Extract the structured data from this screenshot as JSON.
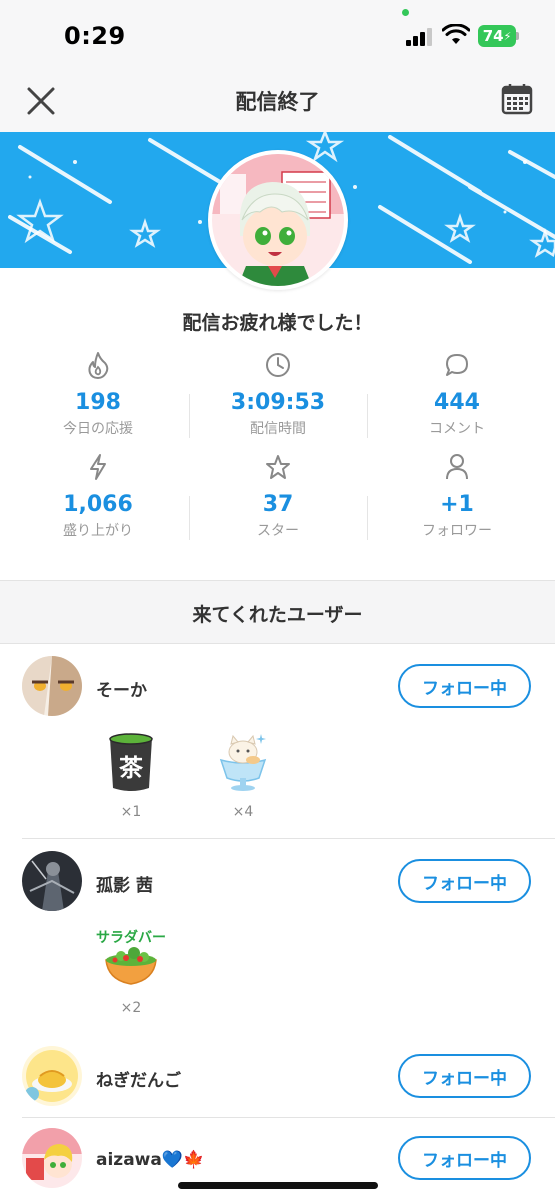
{
  "status_bar": {
    "time": "0:29",
    "battery": "74"
  },
  "nav": {
    "title": "配信終了"
  },
  "summary": {
    "message": "配信お疲れ様でした！"
  },
  "stats": [
    {
      "icon": "flame-icon",
      "value": "198",
      "label": "今日の応援"
    },
    {
      "icon": "clock-icon",
      "value": "3:09:53",
      "label": "配信時間"
    },
    {
      "icon": "comment-icon",
      "value": "444",
      "label": "コメント"
    },
    {
      "icon": "lightning-icon",
      "value": "1,066",
      "label": "盛り上がり"
    },
    {
      "icon": "star-icon",
      "value": "37",
      "label": "スター"
    },
    {
      "icon": "person-icon",
      "value": "+1",
      "label": "フォロワー"
    }
  ],
  "visitors": {
    "title": "来てくれたユーザー",
    "follow_label": "フォロー中",
    "users": [
      {
        "name": "そーか",
        "gifts": [
          {
            "icon": "tea-cup-icon",
            "count": "×1"
          },
          {
            "icon": "cat-parfait-icon",
            "count": "×4"
          }
        ]
      },
      {
        "name": "孤影 茜",
        "gifts": [
          {
            "icon": "salad-bar-icon",
            "label": "サラダバー",
            "count": "×2"
          }
        ]
      },
      {
        "name": "ねぎだんご",
        "gifts": []
      },
      {
        "name": "aizawa💙🍁",
        "gifts": []
      }
    ]
  },
  "colors": {
    "accent": "#1a8fe0",
    "banner": "#22a8ee",
    "battery": "#34c759"
  }
}
